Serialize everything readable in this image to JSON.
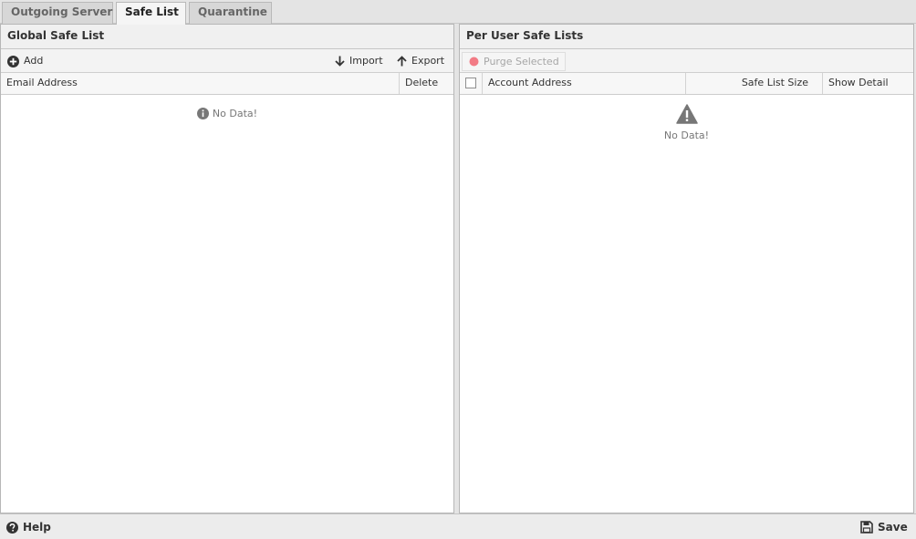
{
  "tabs": [
    {
      "label": "Outgoing Server",
      "active": false
    },
    {
      "label": "Safe List",
      "active": true
    },
    {
      "label": "Quarantine",
      "active": false
    }
  ],
  "global": {
    "title": "Global Safe List",
    "toolbar": {
      "add": "Add",
      "import": "Import",
      "export": "Export"
    },
    "columns": [
      "Email Address",
      "Delete"
    ],
    "empty_text": "No Data!"
  },
  "per_user": {
    "title": "Per User Safe Lists",
    "toolbar": {
      "purge": "Purge Selected"
    },
    "columns": [
      "Account Address",
      "Safe List Size",
      "Show Detail"
    ],
    "empty_text": "No Data!"
  },
  "footer": {
    "help": "Help",
    "save": "Save"
  },
  "colors": {
    "purge_dot": "#f27b85",
    "icon_dark": "#333333",
    "warning_icon": "#777777"
  }
}
